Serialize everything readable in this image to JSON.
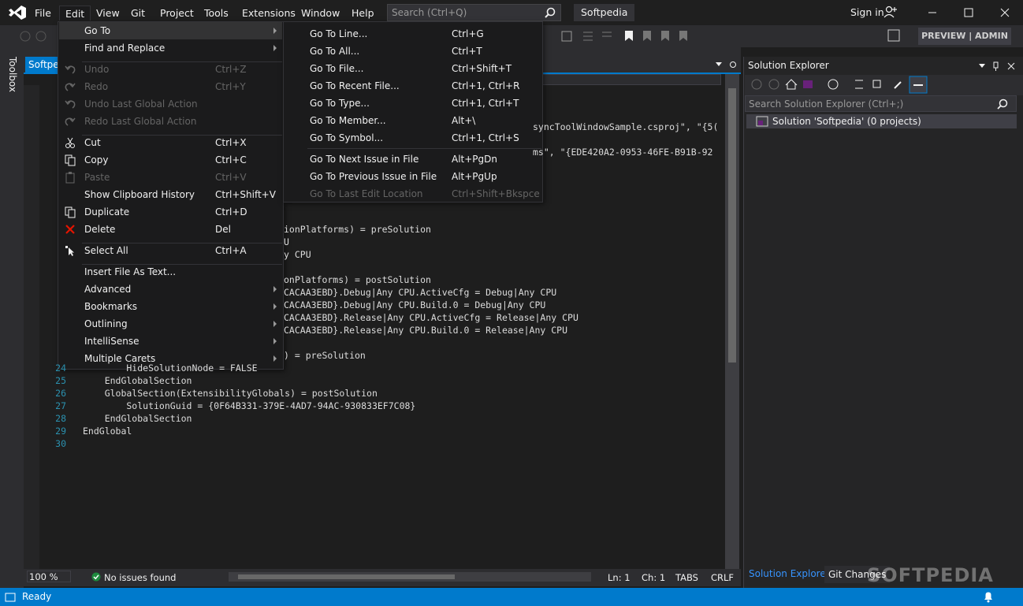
{
  "menubar": {
    "items": [
      "File",
      "Edit",
      "View",
      "Git",
      "Project",
      "Tools",
      "Extensions",
      "Window",
      "Help"
    ],
    "search_placeholder": "Search (Ctrl+Q)",
    "solution_title": "Softpedia",
    "sign_in": "Sign in"
  },
  "toolbar": {
    "preview_label": "PREVIEW | ADMIN"
  },
  "toolbox": {
    "label": "Toolbox"
  },
  "document": {
    "tab_label": "Softpe",
    "lines": [
      {
        "n": "",
        "text": "syncToolWindowSample.csproj\", \"{5("
      },
      {
        "n": "",
        "text": "ms\", \"{EDE420A2-0953-46FE-B91B-92"
      },
      {
        "n": "",
        "text": "ionPlatforms) = preSolution"
      },
      {
        "n": "",
        "text": "U"
      },
      {
        "n": "",
        "text": "y CPU"
      },
      {
        "n": "",
        "text": "onPlatforms) = postSolution"
      },
      {
        "n": "",
        "text": "CACAA3EBD}.Debug|Any CPU.ActiveCfg = Debug|Any CPU"
      },
      {
        "n": "",
        "text": "CACAA3EBD}.Debug|Any CPU.Build.0 = Debug|Any CPU"
      },
      {
        "n": "",
        "text": "CACAA3EBD}.Release|Any CPU.ActiveCfg = Release|Any CPU"
      },
      {
        "n": "",
        "text": "CACAA3EBD}.Release|Any CPU.Build.0 = Release|Any CPU"
      },
      {
        "n": "",
        "text": ") = preSolution"
      },
      {
        "n": "24",
        "text": "        HideSolutionNode = FALSE"
      },
      {
        "n": "25",
        "text": "    EndGlobalSection"
      },
      {
        "n": "26",
        "text": "    GlobalSection(ExtensibilityGlobals) = postSolution"
      },
      {
        "n": "27",
        "text": "        SolutionGuid = {0F64B331-379E-4AD7-94AC-930833EF7C08}"
      },
      {
        "n": "28",
        "text": "    EndGlobalSection"
      },
      {
        "n": "29",
        "text": "EndGlobal"
      },
      {
        "n": "30",
        "text": ""
      }
    ],
    "zoom": "100 %",
    "issues": "No issues found",
    "ln": "Ln: 1",
    "ch": "Ch: 1",
    "tabs": "TABS",
    "crlf": "CRLF"
  },
  "edit_menu": {
    "items": [
      {
        "label": "Go To",
        "shortcut": "",
        "submenu": true,
        "disabled": false,
        "icon": ""
      },
      {
        "label": "Find and Replace",
        "shortcut": "",
        "submenu": true,
        "disabled": false,
        "icon": ""
      },
      {
        "label": "Undo",
        "shortcut": "Ctrl+Z",
        "submenu": false,
        "disabled": true,
        "icon": "undo-icon"
      },
      {
        "label": "Redo",
        "shortcut": "Ctrl+Y",
        "submenu": false,
        "disabled": true,
        "icon": "redo-icon"
      },
      {
        "label": "Undo Last Global Action",
        "shortcut": "",
        "submenu": false,
        "disabled": true,
        "icon": "undo-global-icon"
      },
      {
        "label": "Redo Last Global Action",
        "shortcut": "",
        "submenu": false,
        "disabled": true,
        "icon": "redo-global-icon"
      },
      {
        "label": "Cut",
        "shortcut": "Ctrl+X",
        "submenu": false,
        "disabled": false,
        "icon": "cut-icon"
      },
      {
        "label": "Copy",
        "shortcut": "Ctrl+C",
        "submenu": false,
        "disabled": false,
        "icon": "copy-icon"
      },
      {
        "label": "Paste",
        "shortcut": "Ctrl+V",
        "submenu": false,
        "disabled": true,
        "icon": "paste-icon"
      },
      {
        "label": "Show Clipboard History",
        "shortcut": "Ctrl+Shift+V",
        "submenu": false,
        "disabled": false,
        "icon": ""
      },
      {
        "label": "Duplicate",
        "shortcut": "Ctrl+D",
        "submenu": false,
        "disabled": false,
        "icon": "duplicate-icon"
      },
      {
        "label": "Delete",
        "shortcut": "Del",
        "submenu": false,
        "disabled": false,
        "icon": "delete-icon"
      },
      {
        "label": "Select All",
        "shortcut": "Ctrl+A",
        "submenu": false,
        "disabled": false,
        "icon": "select-all-icon"
      },
      {
        "label": "Insert File As Text...",
        "shortcut": "",
        "submenu": false,
        "disabled": false,
        "icon": ""
      },
      {
        "label": "Advanced",
        "shortcut": "",
        "submenu": true,
        "disabled": false,
        "icon": ""
      },
      {
        "label": "Bookmarks",
        "shortcut": "",
        "submenu": true,
        "disabled": false,
        "icon": ""
      },
      {
        "label": "Outlining",
        "shortcut": "",
        "submenu": true,
        "disabled": false,
        "icon": ""
      },
      {
        "label": "IntelliSense",
        "shortcut": "",
        "submenu": true,
        "disabled": false,
        "icon": ""
      },
      {
        "label": "Multiple Carets",
        "shortcut": "",
        "submenu": true,
        "disabled": false,
        "icon": ""
      }
    ]
  },
  "goto_menu": {
    "items": [
      {
        "label": "Go To Line...",
        "shortcut": "Ctrl+G",
        "disabled": false
      },
      {
        "label": "Go To All...",
        "shortcut": "Ctrl+T",
        "disabled": false
      },
      {
        "label": "Go To File...",
        "shortcut": "Ctrl+Shift+T",
        "disabled": false
      },
      {
        "label": "Go To Recent File...",
        "shortcut": "Ctrl+1, Ctrl+R",
        "disabled": false
      },
      {
        "label": "Go To Type...",
        "shortcut": "Ctrl+1, Ctrl+T",
        "disabled": false
      },
      {
        "label": "Go To Member...",
        "shortcut": "Alt+\\",
        "disabled": false
      },
      {
        "label": "Go To Symbol...",
        "shortcut": "Ctrl+1, Ctrl+S",
        "disabled": false
      },
      {
        "label": "Go To Next Issue in File",
        "shortcut": "Alt+PgDn",
        "disabled": false
      },
      {
        "label": "Go To Previous Issue in File",
        "shortcut": "Alt+PgUp",
        "disabled": false
      },
      {
        "label": "Go To Last Edit Location",
        "shortcut": "Ctrl+Shift+Bkspce",
        "disabled": true
      }
    ]
  },
  "solution_explorer": {
    "title": "Solution Explorer",
    "search_placeholder": "Search Solution Explorer (Ctrl+;)",
    "root": "Solution 'Softpedia' (0 projects)",
    "tab_solution": "Solution Explorer",
    "tab_git": "Git Changes"
  },
  "watermark": "SOFTPEDIA",
  "status": {
    "text": "Ready"
  },
  "colors": {
    "accent": "#007acc",
    "bg": "#1e1e1e",
    "menu_bg": "#1b1b1c"
  }
}
